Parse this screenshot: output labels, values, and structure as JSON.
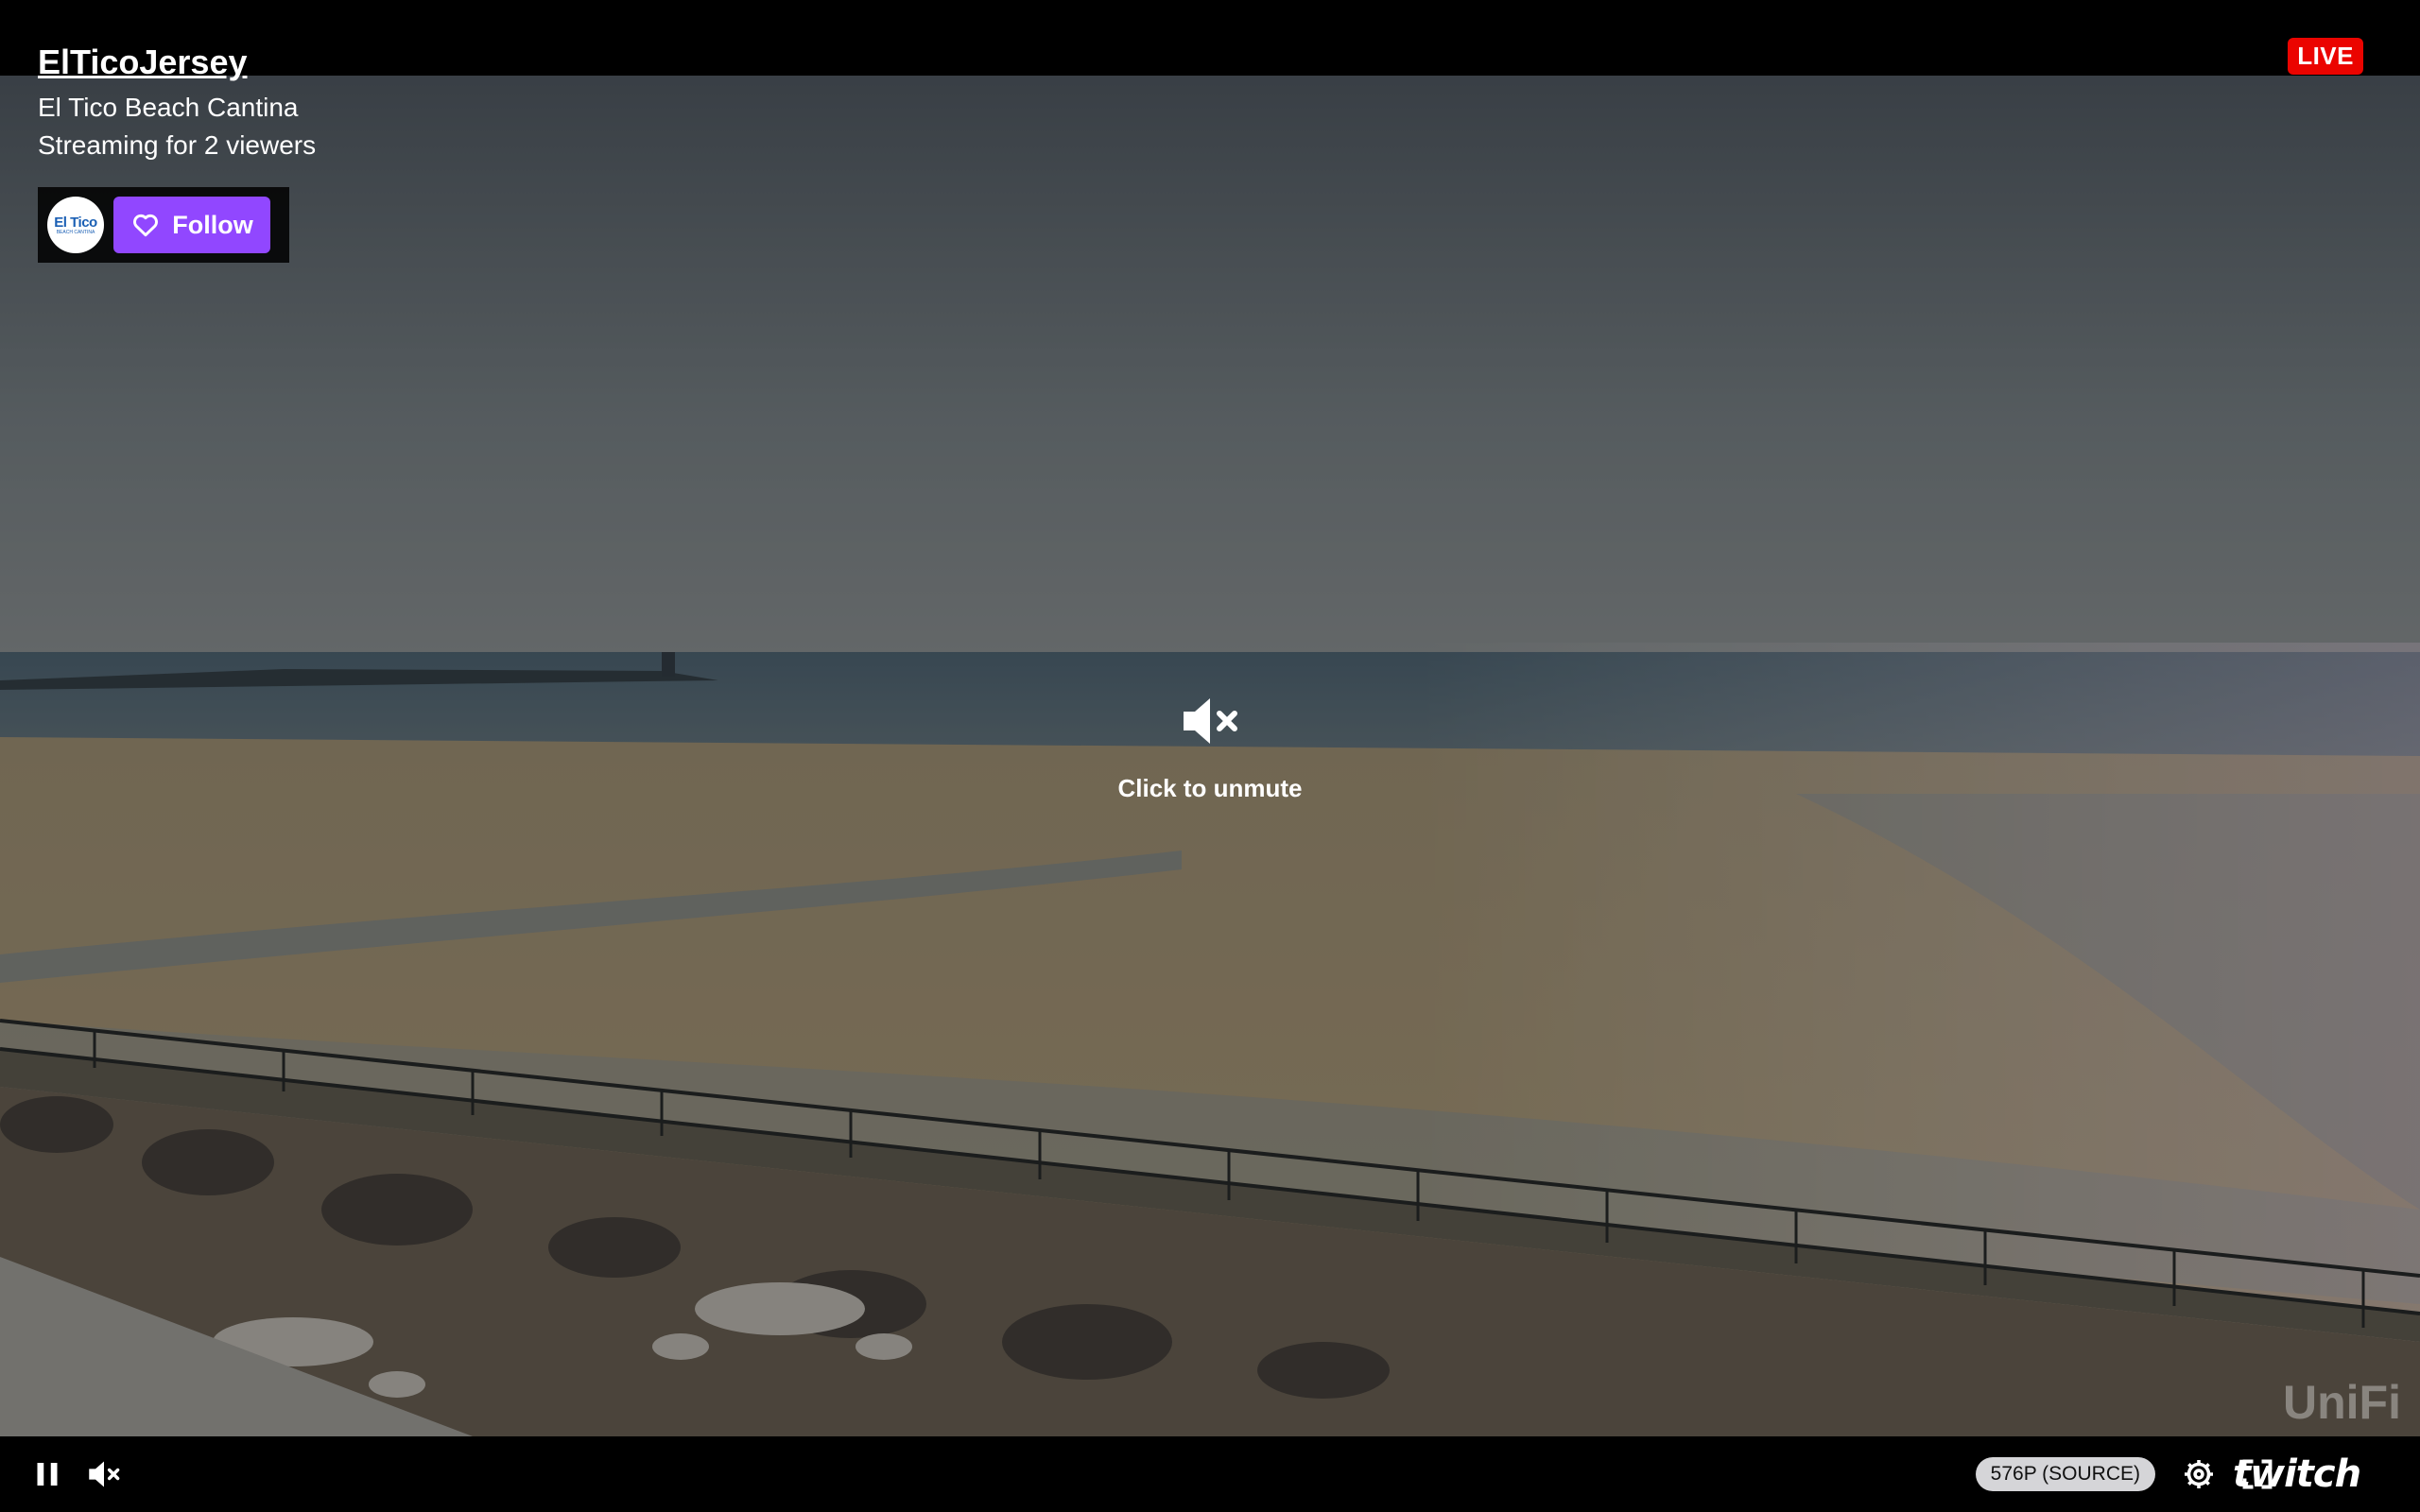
{
  "channel": {
    "name": "ElTicoJersey",
    "stream_title": "El Tico Beach Cantina",
    "viewers_text": "Streaming for 2 viewers",
    "avatar_text": "El Tico",
    "avatar_sub": "BEACH CANTINA"
  },
  "follow": {
    "label": "Follow",
    "icon": "heart-icon"
  },
  "status": {
    "live_label": "LIVE",
    "live_color": "#eb0400"
  },
  "overlay": {
    "unmute_label": "Click to unmute",
    "icon": "muted-speaker-icon"
  },
  "controls": {
    "pause_icon": "pause-icon",
    "volume_icon": "muted-speaker-icon",
    "quality_label": "576P (SOURCE)",
    "settings_icon": "gear-icon",
    "fullscreen_icon": "fullscreen-icon",
    "brand": "twitch"
  },
  "watermark": {
    "text": "UniFi"
  },
  "colors": {
    "accent": "#9147ff",
    "live": "#eb0400"
  }
}
